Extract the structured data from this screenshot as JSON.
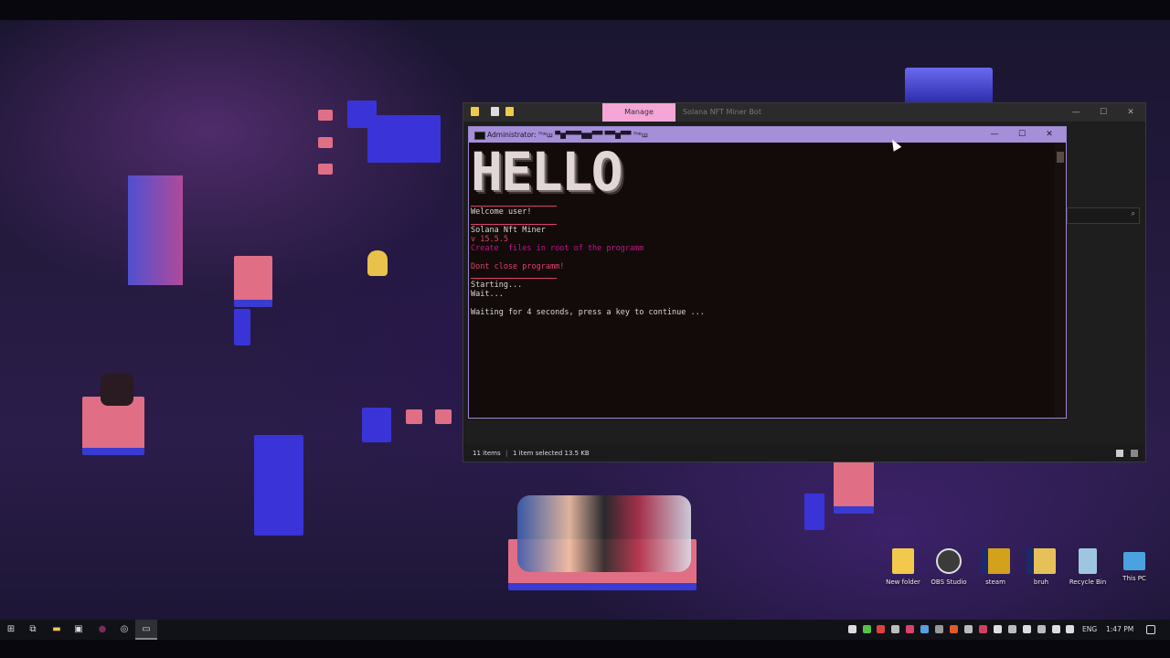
{
  "explorer": {
    "tab_manage": "Manage",
    "title": "Solana NFT Miner Bot",
    "status_items": "11 items",
    "status_selected": "1 item selected  13.5 KB",
    "minimize": "—",
    "maximize": "☐",
    "close": "✕"
  },
  "cmd": {
    "title": "Administrator: ꟸꟹꟺ ▀▆▀▀▀▆▆▀▀ ▀▀▆▀▀ ꟸꟹꟺ",
    "minimize": "—",
    "maximize": "☐",
    "close": "✕",
    "banner": "HELLO",
    "lines": {
      "welcome": "Welcome user!",
      "app_name": "Solana Nft Miner",
      "version": "v 15.5.5",
      "create_files": "Create  files in root of the programm",
      "dont_close": "Dont close programm!",
      "starting": "Starting...",
      "wait": "Wait...",
      "waiting": "Waiting for 4 seconds, press a key to continue ..."
    }
  },
  "desktop_icons": [
    {
      "label": "New folder",
      "icon": "folder-icon",
      "color": "#f2c94c"
    },
    {
      "label": "OBS Studio",
      "icon": "obs-icon",
      "color": "#3b3b3b"
    },
    {
      "label": "steam",
      "icon": "steam-icon",
      "color": "#d4a11d"
    },
    {
      "label": "bruh",
      "icon": "file-icon",
      "color": "#e6c15a"
    },
    {
      "label": "Recycle Bin",
      "icon": "recycle-bin-icon",
      "color": "#9fc6e0"
    },
    {
      "label": "This PC",
      "icon": "computer-icon",
      "color": "#4aa3e0"
    }
  ],
  "taskbar": {
    "start_icon": "windows-start-icon",
    "language": "ENG",
    "time": "1:47 PM"
  },
  "colors": {
    "cmd_title_bg": "#a58fd8",
    "manage_tab_bg": "#f4a6d7",
    "console_red": "#e0406c",
    "console_pink": "#c0148c"
  }
}
